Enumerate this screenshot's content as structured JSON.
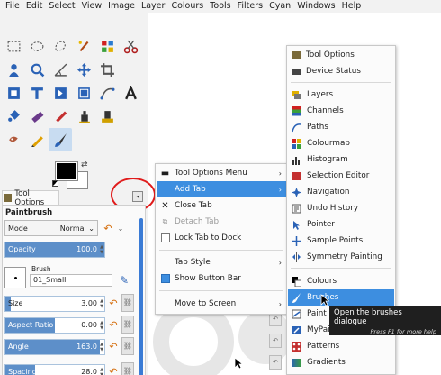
{
  "menubar": [
    "File",
    "Edit",
    "Select",
    "View",
    "Image",
    "Layer",
    "Colours",
    "Tools",
    "Filters",
    "Cyan",
    "Windows",
    "Help"
  ],
  "toolbox": {
    "dock_tab_label": "Tool Options",
    "panel_title": "Paintbrush",
    "mode_label": "Mode",
    "mode_value": "Normal",
    "opacity": {
      "label": "Opacity",
      "value": "100.0",
      "fraction": 1.0
    },
    "brush_label": "Brush",
    "brush_name": "01_Small",
    "sliders": [
      {
        "label": "Size",
        "value": "3.00",
        "fraction": 0.05
      },
      {
        "label": "Aspect Ratio",
        "value": "0.00",
        "fraction": 0.5
      },
      {
        "label": "Angle",
        "value": "163.0",
        "fraction": 0.95
      },
      {
        "label": "Spacing",
        "value": "28.0",
        "fraction": 0.3
      }
    ],
    "fg_color": "#000000",
    "bg_color": "#ffffff",
    "accent_color": "#3d8ee0"
  },
  "menu1": {
    "items": [
      {
        "label": "Tool Options Menu",
        "icon": "tool-options-icon",
        "submenu": true
      },
      {
        "label": "Add Tab",
        "icon": "",
        "submenu": true,
        "highlighted": true
      },
      {
        "label": "Close Tab",
        "icon": "close-icon"
      },
      {
        "label": "Detach Tab",
        "icon": "detach-icon",
        "disabled": true
      },
      {
        "label": "Lock Tab to Dock",
        "icon": "checkbox",
        "checked": false
      },
      {
        "label": "Tab Style",
        "icon": "",
        "submenu": true
      },
      {
        "label": "Show Button Bar",
        "icon": "checkbox",
        "checked": true
      },
      {
        "label": "Move to Screen",
        "icon": "",
        "submenu": true
      }
    ]
  },
  "menu2": {
    "items": [
      {
        "label": "Tool Options",
        "icon": "tool-options-icon"
      },
      {
        "label": "Device Status",
        "icon": "device-status-icon"
      },
      {
        "label": "Layers",
        "icon": "layers-icon"
      },
      {
        "label": "Channels",
        "icon": "channels-icon"
      },
      {
        "label": "Paths",
        "icon": "paths-icon"
      },
      {
        "label": "Colourmap",
        "icon": "colourmap-icon"
      },
      {
        "label": "Histogram",
        "icon": "histogram-icon"
      },
      {
        "label": "Selection Editor",
        "icon": "selection-editor-icon"
      },
      {
        "label": "Navigation",
        "icon": "navigation-icon"
      },
      {
        "label": "Undo History",
        "icon": "undo-history-icon"
      },
      {
        "label": "Pointer",
        "icon": "pointer-icon"
      },
      {
        "label": "Sample Points",
        "icon": "sample-points-icon"
      },
      {
        "label": "Symmetry Painting",
        "icon": "symmetry-icon"
      },
      {
        "label": "Colours",
        "icon": "colours-icon"
      },
      {
        "label": "Brushes",
        "icon": "brushes-icon",
        "highlighted": true
      },
      {
        "label": "Paint D",
        "icon": "paint-dynamics-icon"
      },
      {
        "label": "MyPain",
        "icon": "mypaint-brushes-icon"
      },
      {
        "label": "Patterns",
        "icon": "patterns-icon"
      },
      {
        "label": "Gradients",
        "icon": "gradients-icon"
      }
    ]
  },
  "tooltip": {
    "title": "Open the brushes dialogue",
    "hint": "Press F1 for more help"
  }
}
